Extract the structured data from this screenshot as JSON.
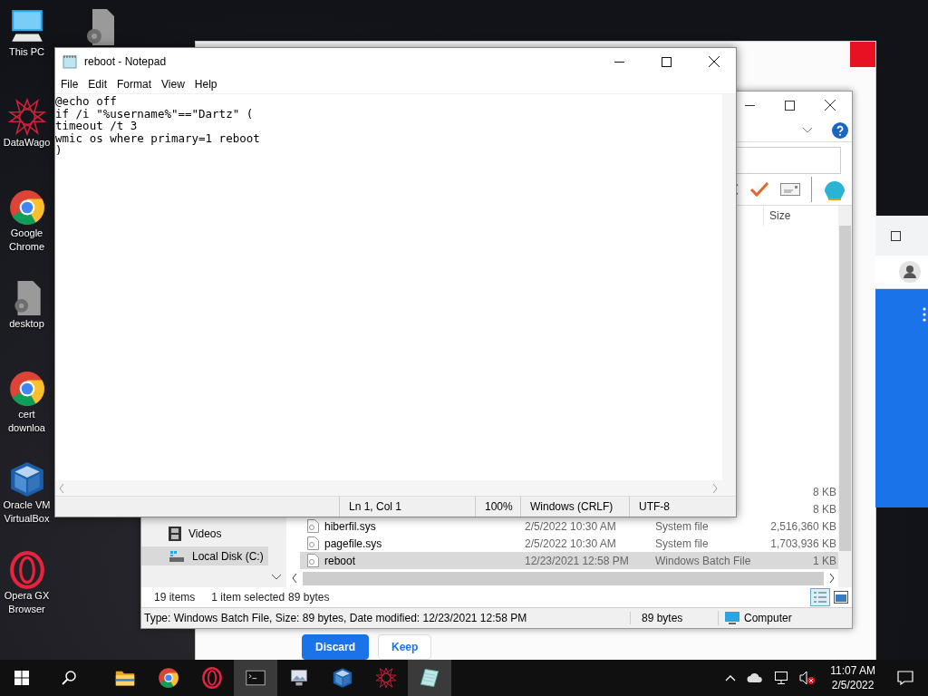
{
  "desktop_icons": [
    {
      "kind": "pc",
      "label": "This PC"
    },
    {
      "kind": "star",
      "label": "DataWago"
    },
    {
      "kind": "chrome",
      "label": "Google Chrome"
    },
    {
      "kind": "gearfile",
      "label": "desktop"
    },
    {
      "kind": "chrome",
      "label": "cert downloa"
    },
    {
      "kind": "vbox",
      "label": "Oracle VM VirtualBox"
    },
    {
      "kind": "opera",
      "label": "Opera GX Browser"
    }
  ],
  "back_window": {
    "buttons": [
      {
        "label": "Discard",
        "kind": "primary"
      },
      {
        "label": "Keep",
        "kind": "secondary"
      }
    ]
  },
  "notepad": {
    "title": "reboot - Notepad",
    "menu": [
      "File",
      "Edit",
      "Format",
      "View",
      "Help"
    ],
    "lines": [
      "@echo off",
      "if /i \"%username%\"==\"Dartz\" (",
      "timeout /t 3",
      "wmic os where primary=1 reboot",
      ")"
    ],
    "status": [
      "Ln 1, Col 1",
      "100%",
      "Windows (CRLF)",
      "UTF-8"
    ]
  },
  "explorer": {
    "column": "Size",
    "nav": [
      {
        "label": "Videos",
        "kind": "film",
        "selected": false
      },
      {
        "label": "Local Disk (C:)",
        "kind": "disk",
        "selected": true
      }
    ],
    "files": [
      {
        "size": "8 KB",
        "selected": false
      },
      {
        "size": "8 KB",
        "selected": false
      },
      {
        "name": "hiberfil.sys",
        "date": "2/5/2022 10:30 AM",
        "type": "System file",
        "size": "2,516,360 KB",
        "selected": false
      },
      {
        "name": "pagefile.sys",
        "date": "2/5/2022 10:30 AM",
        "type": "System file",
        "size": "1,703,936 KB",
        "selected": false
      },
      {
        "name": "reboot",
        "date": "12/23/2021 12:58 PM",
        "type": "Windows Batch File",
        "size": "1 KB",
        "selected": true
      }
    ],
    "item_count": "19 items",
    "selection": "1 item selected",
    "selection_size": "89 bytes",
    "details": "Type: Windows Batch File, Size: 89 bytes, Date modified: 12/23/2021 12:58 PM",
    "details_size": "89 bytes",
    "details_location": "Computer"
  },
  "taskbar": {
    "apps": [
      {
        "kind": "folder",
        "active": false
      },
      {
        "kind": "chrome",
        "active": false
      },
      {
        "kind": "opera",
        "active": false
      },
      {
        "kind": "terminal",
        "active": true
      },
      {
        "kind": "monitor",
        "active": false
      },
      {
        "kind": "vbox",
        "active": false
      },
      {
        "kind": "star",
        "active": false
      },
      {
        "kind": "notepad",
        "active": true
      }
    ],
    "time": "11:07 AM",
    "date": "2/5/2022"
  }
}
